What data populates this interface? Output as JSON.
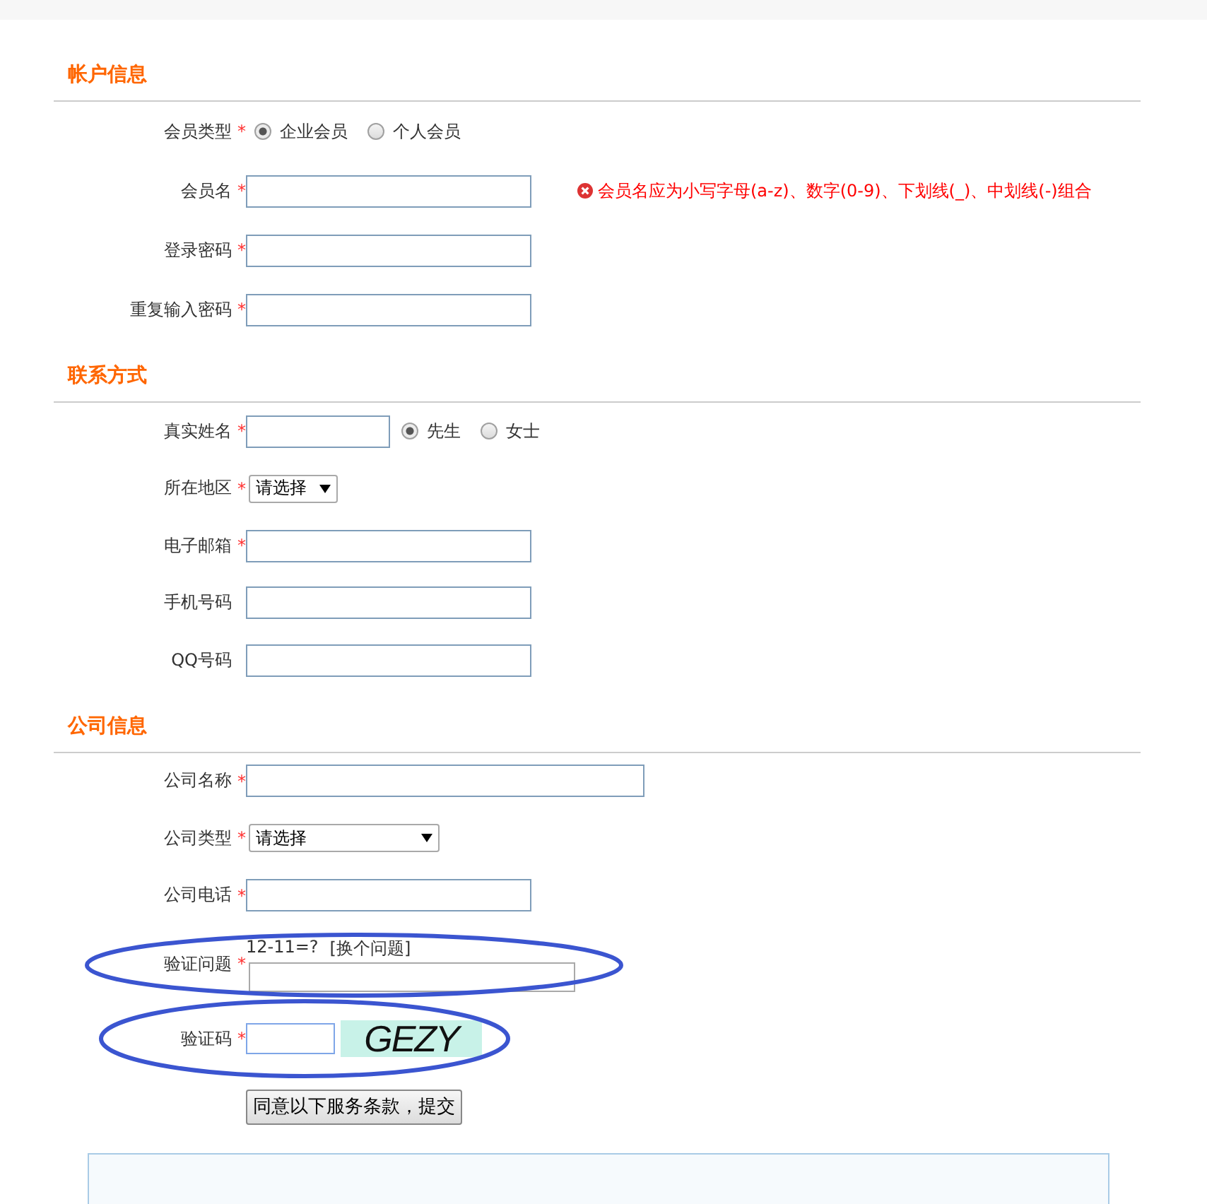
{
  "required_mark": "*",
  "sections": [
    {
      "title": "帐户信息",
      "fields": [
        {
          "kind": "radio",
          "label": "会员类型",
          "required": true,
          "options": [
            {
              "label": "企业会员",
              "selected": true
            },
            {
              "label": "个人会员",
              "selected": false
            }
          ]
        },
        {
          "kind": "text",
          "label": "会员名",
          "required": true,
          "error": "会员名应为小写字母(a-z)、数字(0-9)、下划线(_)、中划线(-)组合"
        },
        {
          "kind": "text",
          "label": "登录密码",
          "required": true
        },
        {
          "kind": "text",
          "label": "重复输入密码",
          "required": true
        }
      ]
    },
    {
      "title": "联系方式",
      "fields": [
        {
          "kind": "name-with-title",
          "label": "真实姓名",
          "required": true,
          "options": [
            {
              "label": "先生",
              "selected": true
            },
            {
              "label": "女士",
              "selected": false
            }
          ]
        },
        {
          "kind": "small-select",
          "label": "所在地区",
          "required": true,
          "value": "请选择"
        },
        {
          "kind": "text",
          "label": "电子邮箱",
          "required": true
        },
        {
          "kind": "text",
          "label": "手机号码",
          "required": false
        },
        {
          "kind": "text",
          "label": "QQ号码",
          "required": false
        }
      ]
    },
    {
      "title": "公司信息",
      "fields": [
        {
          "kind": "long-text",
          "label": "公司名称",
          "required": true
        },
        {
          "kind": "wide-select",
          "label": "公司类型",
          "required": true,
          "value": "请选择"
        },
        {
          "kind": "text",
          "label": "公司电话",
          "required": true
        },
        {
          "kind": "question",
          "label": "验证问题",
          "required": true,
          "question": "12-11=?",
          "change_link": "[换个问题]",
          "annotated": true
        },
        {
          "kind": "captcha",
          "label": "验证码",
          "required": true,
          "captcha": "GEZY",
          "annotated": true
        }
      ]
    }
  ],
  "submit": "同意以下服务条款，提交"
}
